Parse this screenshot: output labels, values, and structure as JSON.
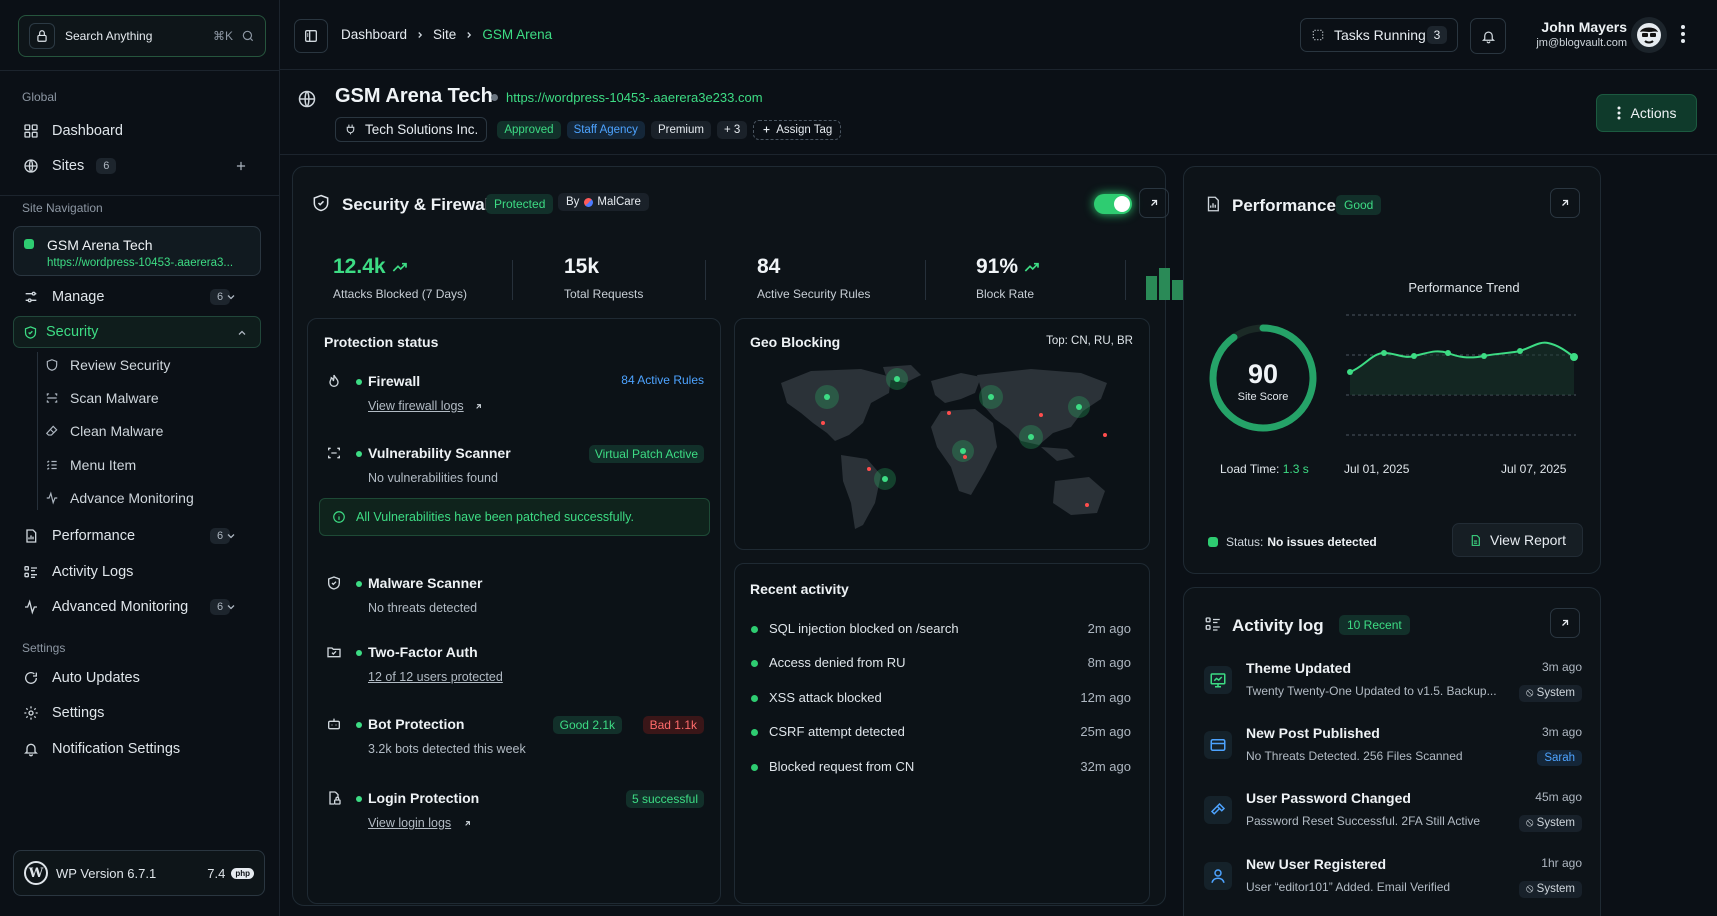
{
  "sidebar": {
    "search_label": "Search Anything",
    "search_shortcut": "⌘K",
    "global_label": "Global",
    "dashboard": "Dashboard",
    "sites": "Sites",
    "sites_count": "6",
    "site_nav_label": "Site Navigation",
    "site_name": "GSM Arena Tech",
    "site_url": "https://wordpress-10453-.aaerera3...",
    "manage": "Manage",
    "manage_count": "6",
    "security": "Security",
    "security_items": [
      "Review Security",
      "Scan Malware",
      "Clean Malware",
      "Menu Item",
      "Advance Monitoring"
    ],
    "performance": "Performance",
    "performance_count": "6",
    "activity_logs": "Activity Logs",
    "advanced_monitoring": "Advanced Monitoring",
    "advanced_count": "6",
    "settings_label": "Settings",
    "auto_updates": "Auto Updates",
    "settings": "Settings",
    "notification_settings": "Notification Settings",
    "wp_version": "WP Version 6.7.1",
    "php_version": "7.4",
    "php_badge": "php"
  },
  "topbar": {
    "breadcrumb": [
      "Dashboard",
      "Site",
      "GSM Arena"
    ],
    "tasks_label": "Tasks Running",
    "tasks_count": "3",
    "user_name": "John Mayers",
    "user_email": "jm@blogvault.com"
  },
  "header": {
    "site_title": "GSM Arena Tech",
    "site_url": "https://wordpress-10453-.aaerera3e233.com",
    "org": "Tech Solutions Inc.",
    "tags": [
      "Approved",
      "Staff Agency",
      "Premium",
      "+ 3"
    ],
    "assign_tag": "Assign Tag",
    "actions": "Actions"
  },
  "security": {
    "title": "Security & Firewall",
    "status": "Protected",
    "by_label": "By",
    "by_vendor": "MalCare",
    "stats": [
      {
        "value": "12.4k",
        "label": "Attacks Blocked (7 Days)"
      },
      {
        "value": "15k",
        "label": "Total Requests"
      },
      {
        "value": "84",
        "label": "Active Security Rules"
      },
      {
        "value": "91%",
        "label": "Block Rate"
      }
    ],
    "protection_title": "Protection status",
    "firewall": "Firewall",
    "firewall_rules": "84 Active Rules",
    "firewall_link": "View firewall logs",
    "vuln": "Vulnerability Scanner",
    "vuln_badge": "Virtual Patch Active",
    "vuln_desc": "No vulnerabilities found",
    "vuln_notice": "All Vulnerabilities have been patched successfully.",
    "malware": "Malware Scanner",
    "malware_desc": "No threats detected",
    "twofa": "Two-Factor Auth",
    "twofa_link": "12 of 12 users protected",
    "bot": "Bot Protection",
    "bot_good": "Good 2.1k",
    "bot_bad": "Bad 1.1k",
    "bot_desc": "3.2k bots detected this week",
    "login": "Login Protection",
    "login_badge": "5 successful",
    "login_link": "View login logs",
    "geo_title": "Geo Blocking",
    "geo_top": "Top: CN, RU, BR",
    "recent_title": "Recent activity",
    "recent": [
      {
        "text": "SQL injection blocked on /search",
        "time": "2m ago"
      },
      {
        "text": "Access denied from RU",
        "time": "8m ago"
      },
      {
        "text": "XSS attack blocked",
        "time": "12m ago"
      },
      {
        "text": "CSRF attempt detected",
        "time": "25m ago"
      },
      {
        "text": "Blocked request from CN",
        "time": "32m ago"
      }
    ]
  },
  "performance": {
    "title": "Performance",
    "status": "Good",
    "score": "90",
    "score_label": "Site Score",
    "score_value": 90,
    "load_label": "Load Time:",
    "load_value": "1.3 s",
    "trend_title": "Performance Trend",
    "date_start": "Jul 01, 2025",
    "date_end": "Jul 07, 2025",
    "status_label": "Status:",
    "status_value": "No issues detected",
    "view_report": "View Report"
  },
  "activity": {
    "title": "Activity log",
    "badge": "10 Recent",
    "items": [
      {
        "title": "Theme Updated",
        "desc": "Twenty Twenty-One Updated to v1.5. Backup...",
        "time": "3m ago",
        "who": "System"
      },
      {
        "title": "New Post Published",
        "desc": "No Threats Detected. 256 Files Scanned",
        "time": "3m ago",
        "who": "Sarah"
      },
      {
        "title": "User Password Changed",
        "desc": "Password Reset Successful. 2FA Still Active",
        "time": "45m ago",
        "who": "System"
      },
      {
        "title": "New User Registered",
        "desc": "User “editor101” Added. Email Verified",
        "time": "1hr ago",
        "who": "System"
      }
    ]
  },
  "colors": {
    "accent": "#3ddc84",
    "background": "#0b1016",
    "panel": "#0d1318",
    "danger": "#ff6b6b",
    "info": "#4da3ff"
  }
}
